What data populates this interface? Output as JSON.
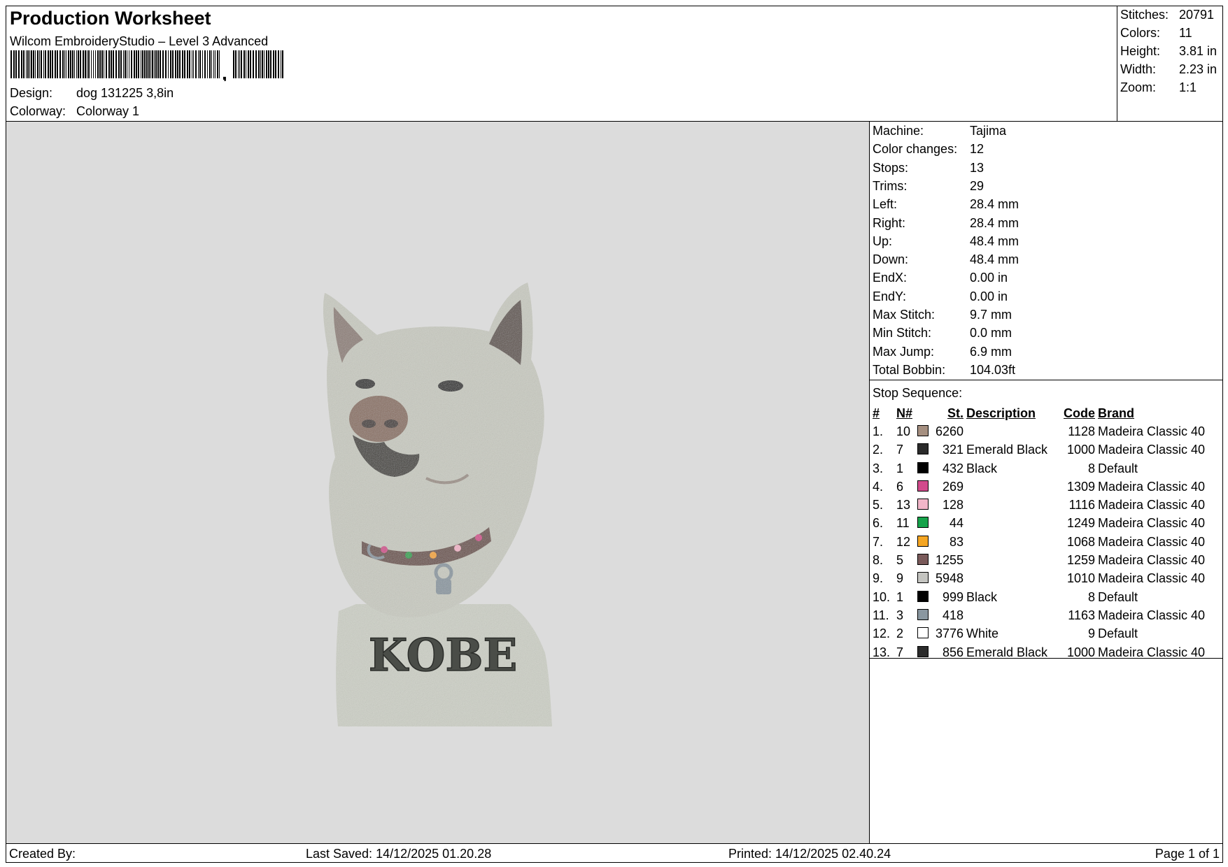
{
  "header": {
    "title": "Production Worksheet",
    "subtitle": "Wilcom EmbroideryStudio – Level 3 Advanced",
    "design_label": "Design:",
    "design_value": "dog  131225 3,8in",
    "colorway_label": "Colorway:",
    "colorway_value": "Colorway 1"
  },
  "stats": [
    {
      "label": "Stitches:",
      "value": "20791"
    },
    {
      "label": "Colors:",
      "value": "11"
    },
    {
      "label": "Height:",
      "value": "3.81 in"
    },
    {
      "label": "Width:",
      "value": "2.23 in"
    },
    {
      "label": "Zoom:",
      "value": "1:1"
    }
  ],
  "design_text": "KOBE",
  "info": [
    {
      "label": "Machine:",
      "value": "Tajima"
    },
    {
      "label": "Color changes:",
      "value": "12"
    },
    {
      "label": "Stops:",
      "value": "13"
    },
    {
      "label": "Trims:",
      "value": "29"
    },
    {
      "label": "Left:",
      "value": "28.4 mm"
    },
    {
      "label": "Right:",
      "value": "28.4 mm"
    },
    {
      "label": "Up:",
      "value": "48.4 mm"
    },
    {
      "label": "Down:",
      "value": "48.4 mm"
    },
    {
      "label": "EndX:",
      "value": "0.00 in"
    },
    {
      "label": "EndY:",
      "value": "0.00 in"
    },
    {
      "label": "Max Stitch:",
      "value": "9.7 mm"
    },
    {
      "label": "Min Stitch:",
      "value": "0.0 mm"
    },
    {
      "label": "Max Jump:",
      "value": "6.9 mm"
    },
    {
      "label": "Total Bobbin:",
      "value": "104.03ft"
    }
  ],
  "stop_sequence": {
    "title": "Stop Sequence:",
    "headers": {
      "num": "#",
      "n": "N#",
      "st": "St.",
      "desc": "Description",
      "code": "Code",
      "brand": "Brand"
    },
    "rows": [
      {
        "num": "1.",
        "n": "10",
        "color": "#a58f80",
        "st": "6260",
        "desc": "",
        "code": "1128",
        "brand": "Madeira Classic 40"
      },
      {
        "num": "2.",
        "n": "7",
        "color": "#2b2b2b",
        "st": "321",
        "desc": "Emerald Black",
        "code": "1000",
        "brand": "Madeira Classic 40"
      },
      {
        "num": "3.",
        "n": "1",
        "color": "#000000",
        "st": "432",
        "desc": "Black",
        "code": "8",
        "brand": "Default"
      },
      {
        "num": "4.",
        "n": "6",
        "color": "#d24a8c",
        "st": "269",
        "desc": "",
        "code": "1309",
        "brand": "Madeira Classic 40"
      },
      {
        "num": "5.",
        "n": "13",
        "color": "#f2b6c9",
        "st": "128",
        "desc": "",
        "code": "1116",
        "brand": "Madeira Classic 40"
      },
      {
        "num": "6.",
        "n": "11",
        "color": "#16a34a",
        "st": "44",
        "desc": "",
        "code": "1249",
        "brand": "Madeira Classic 40"
      },
      {
        "num": "7.",
        "n": "12",
        "color": "#f5a623",
        "st": "83",
        "desc": "",
        "code": "1068",
        "brand": "Madeira Classic 40"
      },
      {
        "num": "8.",
        "n": "5",
        "color": "#7a5a5a",
        "st": "1255",
        "desc": "",
        "code": "1259",
        "brand": "Madeira Classic 40"
      },
      {
        "num": "9.",
        "n": "9",
        "color": "#c4c4c0",
        "st": "5948",
        "desc": "",
        "code": "1010",
        "brand": "Madeira Classic 40"
      },
      {
        "num": "10.",
        "n": "1",
        "color": "#000000",
        "st": "999",
        "desc": "Black",
        "code": "8",
        "brand": "Default"
      },
      {
        "num": "11.",
        "n": "3",
        "color": "#8a97a0",
        "st": "418",
        "desc": "",
        "code": "1163",
        "brand": "Madeira Classic 40"
      },
      {
        "num": "12.",
        "n": "2",
        "color": "#ffffff",
        "st": "3776",
        "desc": "White",
        "code": "9",
        "brand": "Default"
      },
      {
        "num": "13.",
        "n": "7",
        "color": "#2b2b2b",
        "st": "856",
        "desc": "Emerald Black",
        "code": "1000",
        "brand": "Madeira Classic 40"
      }
    ]
  },
  "footer": {
    "created_by": "Created By:",
    "last_saved": "Last Saved: 14/12/2025 01.20.28",
    "printed": "Printed: 14/12/2025 02.40.24",
    "page": "Page 1 of 1"
  }
}
